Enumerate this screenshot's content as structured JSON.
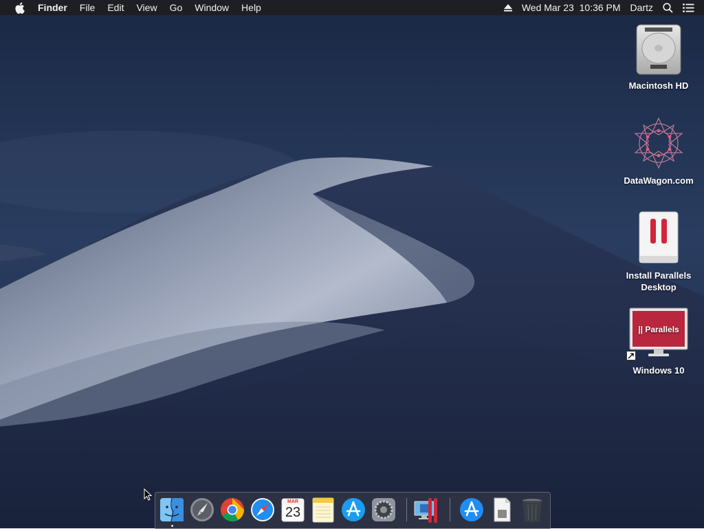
{
  "menubar": {
    "app_name": "Finder",
    "menus": [
      "File",
      "Edit",
      "View",
      "Go",
      "Window",
      "Help"
    ],
    "clock": "Wed Mar 23  10:36 PM",
    "user": "Dartz",
    "icons": [
      "apple-icon",
      "eject-icon",
      "spotlight-search-icon",
      "notification-center-icon"
    ]
  },
  "desktop": {
    "icons": [
      {
        "label": "Macintosh HD",
        "icon": "hard-drive-icon"
      },
      {
        "label": "DataWagon.com",
        "icon": "datawagon-logo-icon"
      },
      {
        "label": "Install Parallels Desktop",
        "icon": "parallels-installer-icon"
      },
      {
        "label": "Windows 10",
        "icon": "parallels-vm-icon",
        "badge_text": "|| Parallels"
      }
    ]
  },
  "dock": {
    "items": [
      {
        "name": "Finder",
        "icon": "finder-icon",
        "running": true
      },
      {
        "name": "Launchpad",
        "icon": "launchpad-icon"
      },
      {
        "name": "Google Chrome",
        "icon": "chrome-icon"
      },
      {
        "name": "Safari",
        "icon": "safari-icon"
      },
      {
        "name": "Calendar",
        "icon": "calendar-icon",
        "month": "MAR",
        "day": "23"
      },
      {
        "name": "Notes",
        "icon": "notes-icon"
      },
      {
        "name": "App Store",
        "icon": "app-store-icon"
      },
      {
        "name": "System Preferences",
        "icon": "system-preferences-icon"
      },
      {
        "name": "Parallels Desktop",
        "icon": "parallels-desktop-icon"
      },
      {
        "name": "Applications",
        "icon": "applications-folder-icon"
      },
      {
        "name": "Downloads",
        "icon": "downloads-stack-icon"
      },
      {
        "name": "Trash",
        "icon": "trash-icon"
      }
    ]
  },
  "colors": {
    "menubar_bg": "#1e1e22",
    "sky_top": "#1c2a45",
    "dune_light": "#9aa4b8",
    "parallels_red": "#d0263a"
  }
}
